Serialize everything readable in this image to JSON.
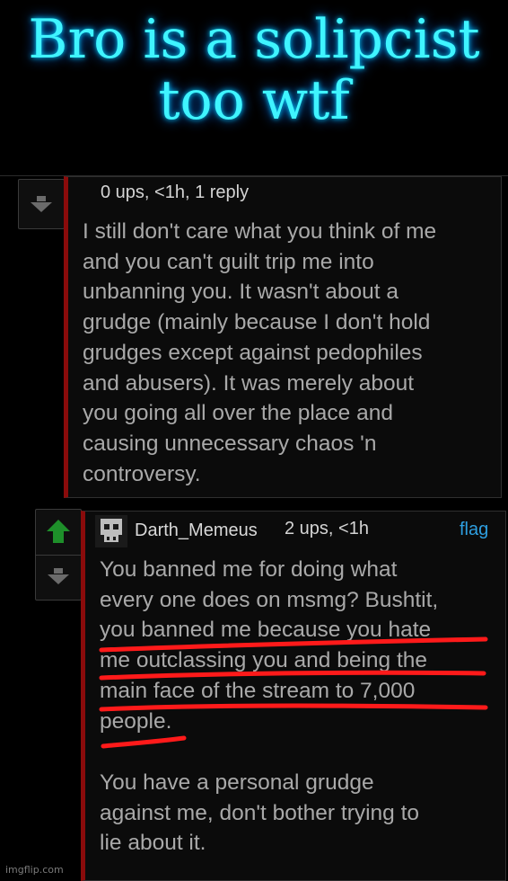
{
  "caption": {
    "text": "Bro is a solipcist too wtf",
    "color": "#3ff4ff"
  },
  "comment1": {
    "meta": "0 ups, <1h, 1 reply",
    "body": "I still don't care what you think of me\nand you can't guilt trip me into\nunbanning you. It wasn't about a\ngrudge (mainly because I don't hold\ngrudges except against pedophiles\nand abusers). It was merely about\nyou going all over the place and\ncausing unnecessary chaos 'n\ncontroversy."
  },
  "comment2": {
    "username": "Darth_Memeus",
    "meta": "2 ups, <1h",
    "flag": "flag",
    "paragraph1": "You banned me for doing what\nevery one does on msmg? Bushtit,\nyou banned me because you hate\nme outclassing you and being the\nmain face of the stream to 7,000\npeople.",
    "paragraph2": "You have a personal grudge\nagainst me, don't bother trying to\nlie about it."
  },
  "watermark": "imgflip.com",
  "icons": [
    "upvote-arrow-icon",
    "downvote-arrow-icon",
    "avatar-icon"
  ],
  "colors": {
    "upvote_active": "#1e8f2a",
    "vote_inactive": "#6b6b6b",
    "reply_bar": "#8a0b0b",
    "link": "#2e9fe0",
    "annotation": "#ff1a1a"
  }
}
